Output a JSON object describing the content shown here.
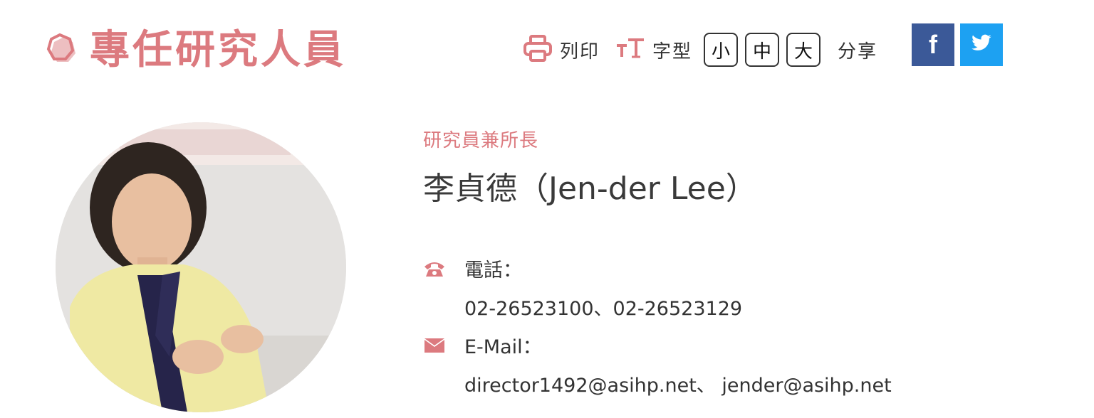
{
  "header": {
    "title": "專任研究人員"
  },
  "toolbar": {
    "print_label": "列印",
    "font_label": "字型",
    "size_small": "小",
    "size_medium": "中",
    "size_large": "大",
    "share_label": "分享",
    "facebook_label": "f"
  },
  "profile": {
    "job_title": "研究員兼所長",
    "name": "李貞德（Jen-der Lee）",
    "phone_label": "電話：",
    "phone_value": "02-26523100、02-26523129",
    "email_label": "E-Mail：",
    "email_value": "director1492@asihp.net、 jender@asihp.net"
  },
  "colors": {
    "accent": "#dc7a7f",
    "facebook": "#3b5998",
    "twitter": "#1da1f2"
  },
  "icons": [
    "hexagon-logo-icon",
    "printer-icon",
    "font-size-icon",
    "facebook-icon",
    "twitter-icon",
    "phone-icon",
    "mail-icon"
  ]
}
